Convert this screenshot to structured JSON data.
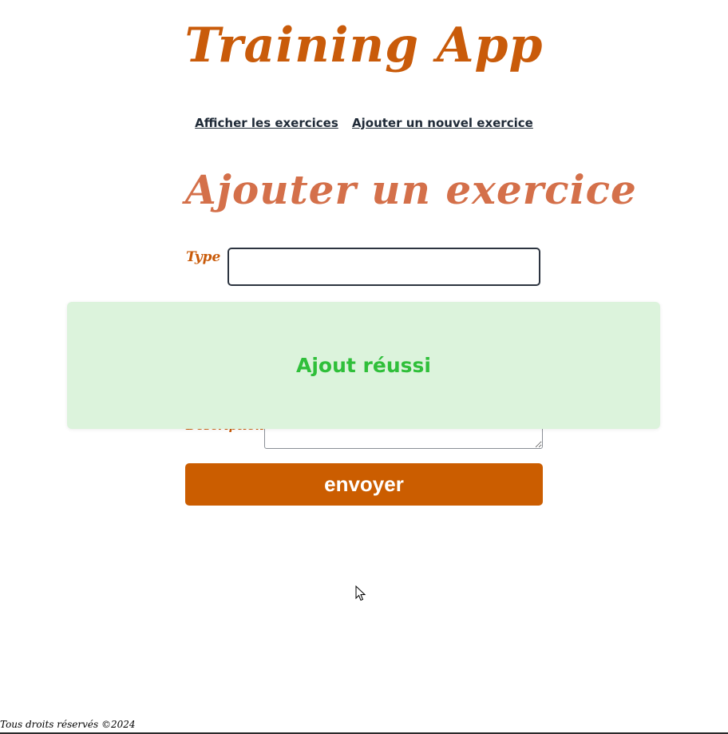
{
  "app": {
    "title": "Training App"
  },
  "nav": {
    "links": [
      {
        "label": "Afficher les exercices"
      },
      {
        "label": "Ajouter un nouvel exercice"
      }
    ]
  },
  "form": {
    "heading": "Ajouter un exercice",
    "type_label": "Type",
    "type_value": "",
    "description_label": "Description",
    "submit_label": "envoyer"
  },
  "toast": {
    "message": "Ajout réussi"
  },
  "footer": {
    "text": "Tous droits réservés ©2024"
  },
  "colors": {
    "brand": "#c95b0a",
    "heading": "#d4704a",
    "button": "#cb5d00",
    "toast_bg": "#dcf3dc",
    "toast_text": "#2fbf3a"
  }
}
